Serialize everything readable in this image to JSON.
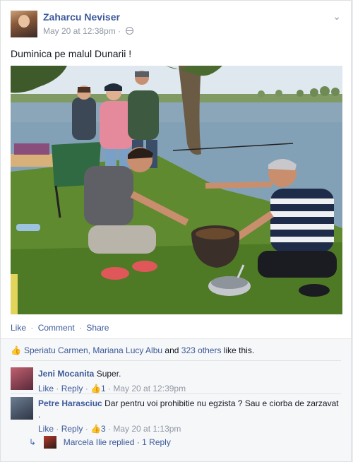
{
  "post": {
    "author": "Zaharcu Neviser",
    "timestamp": "May 20 at 12:38pm",
    "dot": "·",
    "message": "Duminica pe malul Dunarii !",
    "chevron_icon": "chevron-down-icon",
    "privacy_icon": "globe-icon"
  },
  "actions": {
    "like": "Like",
    "comment": "Comment",
    "share": "Share",
    "sep": "·"
  },
  "likes": {
    "names": "Speriatu Carmen, Mariana Lucy Albu",
    "joiner": " and ",
    "others": "323 others",
    "suffix": " like this."
  },
  "comments": [
    {
      "author": "Jeni Mocanita",
      "text": "Super.",
      "like": "Like",
      "reply": "Reply",
      "like_count": "1",
      "timestamp": "May 20 at 12:39pm"
    },
    {
      "author": "Petre Harasciuc",
      "text": "Dar pentru voi prohibitie nu egzista ? Sau e ciorba de zarzavat .",
      "like": "Like",
      "reply": "Reply",
      "like_count": "3",
      "timestamp": "May 20 at 1:13pm",
      "reply_summary": {
        "author": "Marcela Ilie",
        "replied": "replied",
        "count": "1 Reply"
      }
    }
  ],
  "colors": {
    "link": "#3b5998",
    "meta": "#9197a3",
    "panel": "#f6f7f9"
  }
}
